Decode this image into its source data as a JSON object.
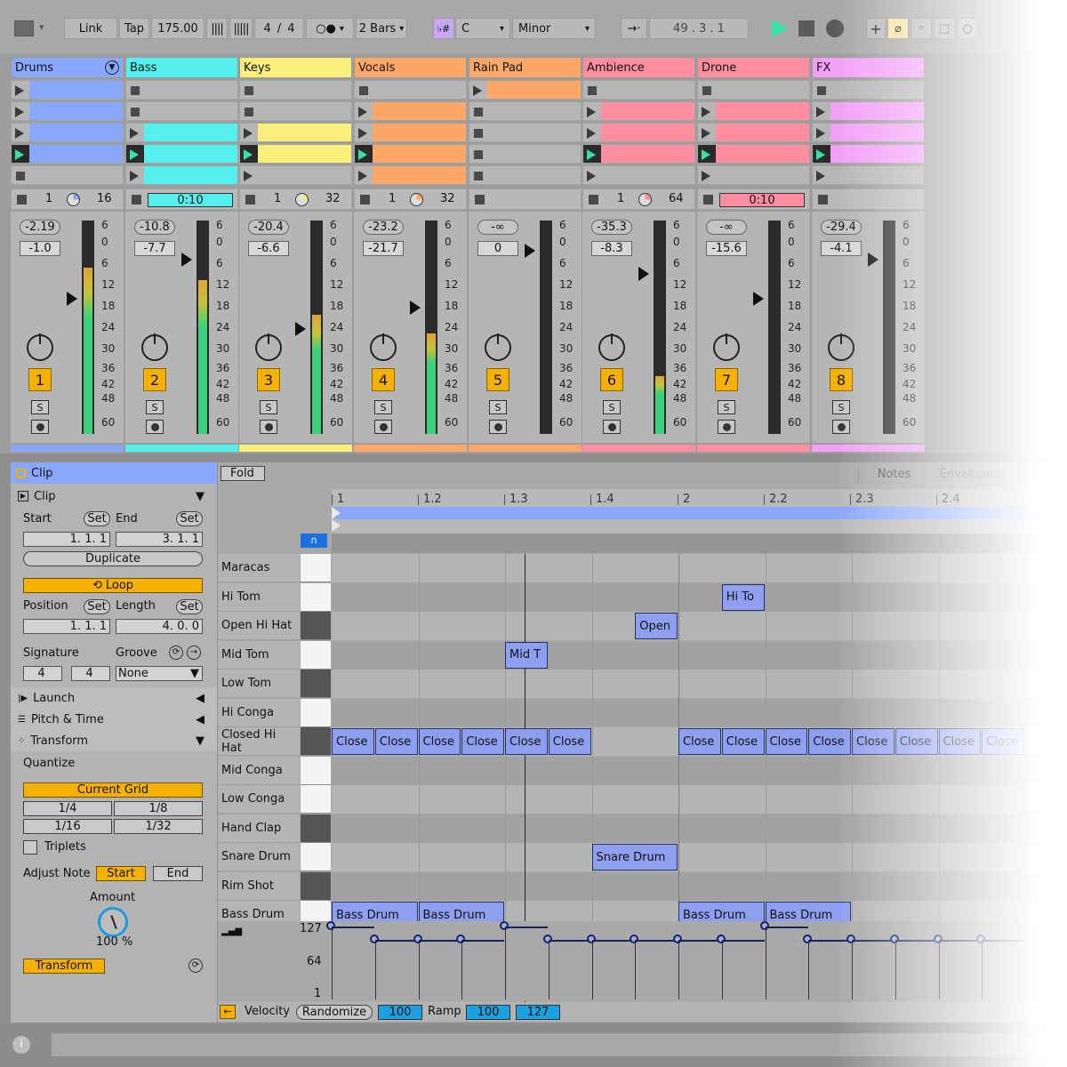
{
  "transport": {
    "link": "Link",
    "tap": "Tap",
    "tempo": "175.00",
    "signature_num": "4",
    "signature_slash": "/",
    "signature_den": "4",
    "quantize": "2 Bars",
    "scale_root": "C",
    "scale_mode": "Minor",
    "position": "49 .  3 .  1",
    "colors": {
      "play": "#35e0a9",
      "accent": "#f6b000"
    }
  },
  "tracks": [
    {
      "name": "Drums",
      "color": "#8aa8fb",
      "vol": "-2.19",
      "pan": "-1.0",
      "num": "1",
      "loop_start": "1",
      "loop_len": "16",
      "slot_kind": "play"
    },
    {
      "name": "Bass",
      "color": "#53f0ee",
      "vol": "-10.8",
      "pan": "-7.7",
      "num": "2",
      "clip_time": "0:10",
      "slot_kind": "stop"
    },
    {
      "name": "Keys",
      "color": "#fbef7a",
      "vol": "-20.4",
      "pan": "-6.6",
      "num": "3",
      "loop_start": "1",
      "loop_len": "32",
      "slot_kind": "stop"
    },
    {
      "name": "Vocals",
      "color": "#fda866",
      "vol": "-23.2",
      "pan": "-21.7",
      "num": "4",
      "loop_start": "1",
      "loop_len": "32",
      "slot_kind": "stop"
    },
    {
      "name": "Rain Pad",
      "color": "#fda866",
      "vol": "-∞",
      "pan": "0",
      "num": "5",
      "slot_kind": "play"
    },
    {
      "name": "Ambience",
      "color": "#ff8ea0",
      "vol": "-35.3",
      "pan": "-8.3",
      "num": "6",
      "loop_start": "1",
      "loop_len": "64",
      "slot_kind": "stop"
    },
    {
      "name": "Drone",
      "color": "#ff8ea0",
      "vol": "-∞",
      "pan": "-15.6",
      "num": "7",
      "clip_time": "0:10",
      "slot_kind": "stop"
    },
    {
      "name": "FX",
      "color": "#f2a0f6",
      "vol": "-29.4",
      "pan": "-4.1",
      "num": "8",
      "slot_kind": "stop"
    }
  ],
  "meter_scale": [
    "6",
    "0",
    "6",
    "12",
    "18",
    "24",
    "30",
    "36",
    "42",
    "48",
    "60"
  ],
  "solo_label": "S",
  "clip_panel": {
    "title": "Clip",
    "section": "Clip",
    "start_label": "Start",
    "end_label": "End",
    "set_label": "Set",
    "start_value": "1.   1.   1",
    "end_value": "3.   1.   1",
    "duplicate": "Duplicate",
    "loop": "Loop",
    "position_label": "Position",
    "length_label": "Length",
    "position_value": "1.   1.   1",
    "length_value": "4.   0.   0",
    "signature_label": "Signature",
    "groove_label": "Groove",
    "sig_num": "4",
    "sig_den": "4",
    "groove_value": "None",
    "launch": "Launch",
    "pitch_time": "Pitch & Time",
    "transform": "Transform",
    "quantize": "Quantize",
    "current_grid": "Current Grid",
    "grid_options": [
      "1/4",
      "1/8",
      "1/16",
      "1/32"
    ],
    "triplets": "Triplets",
    "adjust_note": "Adjust Note",
    "adj_start": "Start",
    "adj_end": "End",
    "amount_label": "Amount",
    "amount_value": "100 %",
    "transform_btn": "Transform"
  },
  "editor": {
    "fold": "Fold",
    "notes_tab": "Notes",
    "envelopes_tab": "Envelopes",
    "ruler": [
      "1",
      "1.2",
      "1.3",
      "1.4",
      "2",
      "2.2",
      "2.3",
      "2.4"
    ],
    "lanes": [
      "Maracas",
      "Hi Tom",
      "Open Hi Hat",
      "Mid Tom",
      "Low Tom",
      "Hi Conga",
      "Closed Hi Hat",
      "Mid Conga",
      "Low Conga",
      "Hand Clap",
      "Snare Drum",
      "Rim Shot",
      "Bass Drum"
    ],
    "notes": [
      {
        "lane": 1,
        "beat": 4.5,
        "len": 0.5,
        "label": "Hi To"
      },
      {
        "lane": 2,
        "beat": 3.5,
        "len": 0.5,
        "label": "Open"
      },
      {
        "lane": 3,
        "beat": 2.0,
        "len": 0.5,
        "label": "Mid T"
      },
      {
        "lane": 6,
        "beat": 0.0,
        "len": 0.5,
        "label": "Close"
      },
      {
        "lane": 6,
        "beat": 0.5,
        "len": 0.5,
        "label": "Close"
      },
      {
        "lane": 6,
        "beat": 1.0,
        "len": 0.5,
        "label": "Close"
      },
      {
        "lane": 6,
        "beat": 1.5,
        "len": 0.5,
        "label": "Close"
      },
      {
        "lane": 6,
        "beat": 2.0,
        "len": 0.5,
        "label": "Close"
      },
      {
        "lane": 6,
        "beat": 2.5,
        "len": 0.5,
        "label": "Close"
      },
      {
        "lane": 6,
        "beat": 4.0,
        "len": 0.5,
        "label": "Close"
      },
      {
        "lane": 6,
        "beat": 4.5,
        "len": 0.5,
        "label": "Close"
      },
      {
        "lane": 6,
        "beat": 5.0,
        "len": 0.5,
        "label": "Close"
      },
      {
        "lane": 6,
        "beat": 5.5,
        "len": 0.5,
        "label": "Close"
      },
      {
        "lane": 6,
        "beat": 6.0,
        "len": 0.5,
        "label": "Close"
      },
      {
        "lane": 6,
        "beat": 6.5,
        "len": 0.5,
        "label": "Close"
      },
      {
        "lane": 6,
        "beat": 7.0,
        "len": 0.5,
        "label": "Close"
      },
      {
        "lane": 6,
        "beat": 7.5,
        "len": 0.5,
        "label": "Close"
      },
      {
        "lane": 10,
        "beat": 3.0,
        "len": 1.0,
        "label": "Snare Drum"
      },
      {
        "lane": 12,
        "beat": 0.0,
        "len": 1.0,
        "label": "Bass Drum"
      },
      {
        "lane": 12,
        "beat": 1.0,
        "len": 1.0,
        "label": "Bass Drum"
      },
      {
        "lane": 12,
        "beat": 4.0,
        "len": 1.0,
        "label": "Bass Drum"
      },
      {
        "lane": 12,
        "beat": 5.0,
        "len": 1.0,
        "label": "Bass Drum"
      }
    ],
    "vel_scale": [
      "127",
      "64",
      "1"
    ],
    "velocity_label": "Velocity",
    "randomize": "Randomize",
    "velocity_value": "100",
    "ramp_label": "Ramp",
    "ramp_from": "100",
    "ramp_to": "127"
  }
}
